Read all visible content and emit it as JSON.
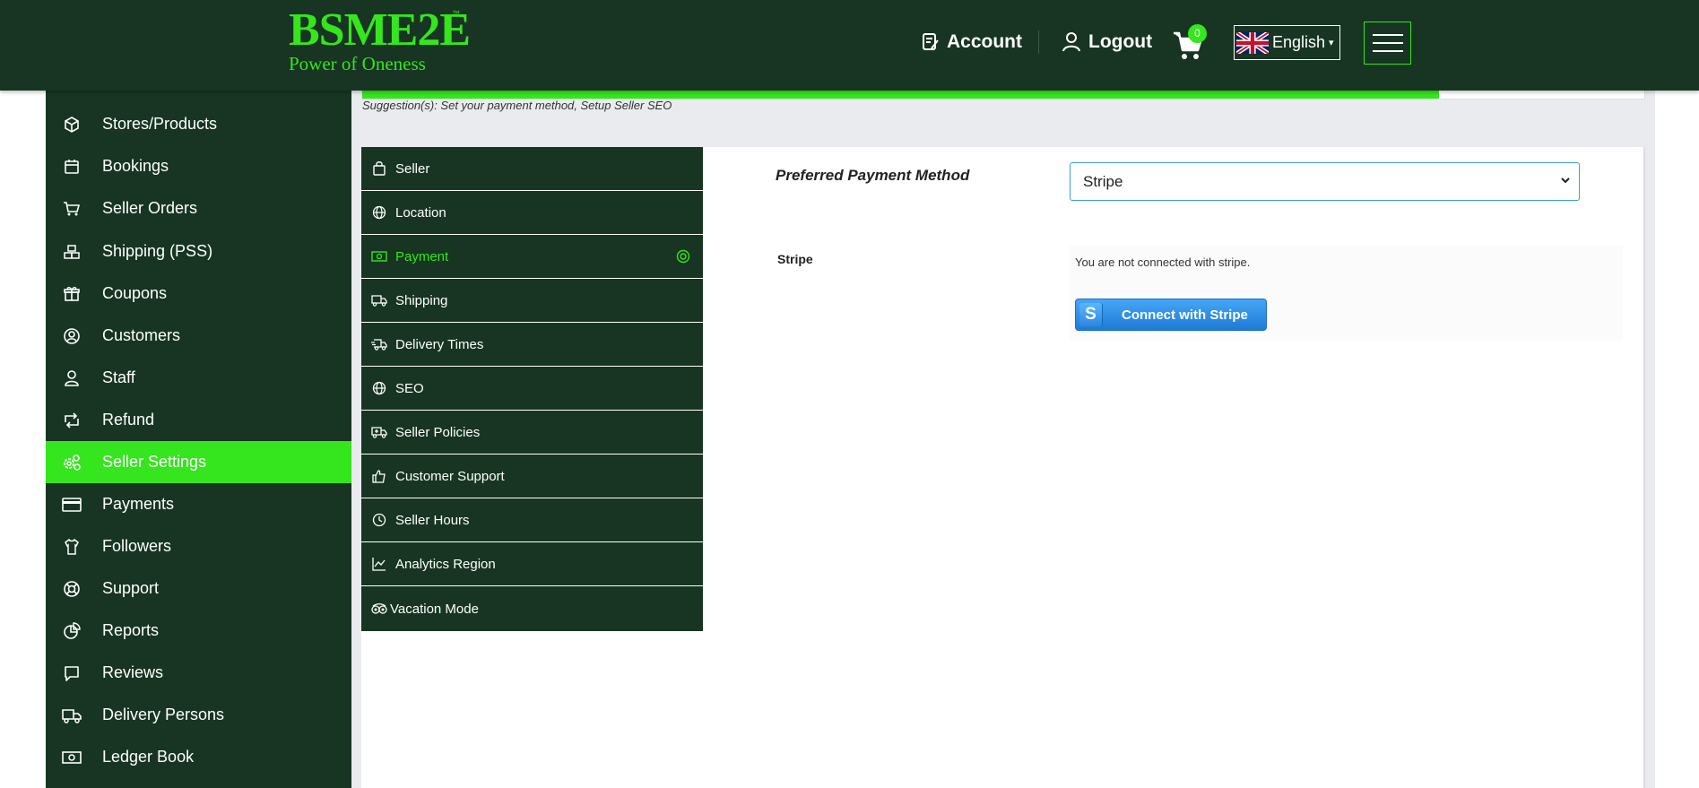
{
  "header": {
    "logo_main": "BSME2E",
    "logo_tm": "™",
    "logo_sub": "Power of Oneness",
    "account_label": "Account",
    "logout_label": "Logout",
    "cart_count": "0",
    "language": "English",
    "language_caret": "▾"
  },
  "sidebar": {
    "items": [
      {
        "label": "Stores/Products",
        "icon": "box-icon"
      },
      {
        "label": "Bookings",
        "icon": "calendar-icon"
      },
      {
        "label": "Seller Orders",
        "icon": "cart-icon"
      },
      {
        "label": "Shipping (PSS)",
        "icon": "boxes-icon"
      },
      {
        "label": "Coupons",
        "icon": "gift-icon"
      },
      {
        "label": "Customers",
        "icon": "user-circle-icon"
      },
      {
        "label": "Staff",
        "icon": "user-icon"
      },
      {
        "label": "Refund",
        "icon": "retweet-icon"
      },
      {
        "label": "Seller Settings",
        "icon": "cogs-icon"
      },
      {
        "label": "Payments",
        "icon": "credit-card-icon"
      },
      {
        "label": "Followers",
        "icon": "shirt-icon"
      },
      {
        "label": "Support",
        "icon": "life-ring-icon"
      },
      {
        "label": "Reports",
        "icon": "pie-chart-icon"
      },
      {
        "label": "Reviews",
        "icon": "comment-icon"
      },
      {
        "label": "Delivery Persons",
        "icon": "truck-icon"
      },
      {
        "label": "Ledger Book",
        "icon": "money-icon"
      }
    ],
    "active_index": 8
  },
  "progress": {
    "fraction": 0.84,
    "suggestion": "Suggestion(s): Set your payment method, Setup Seller SEO"
  },
  "settings_menu": {
    "items": [
      {
        "label": "Seller",
        "icon": "shopping-bag-icon"
      },
      {
        "label": "Location",
        "icon": "globe-icon"
      },
      {
        "label": "Payment",
        "icon": "money-bill-icon"
      },
      {
        "label": "Shipping",
        "icon": "truck-icon"
      },
      {
        "label": "Delivery Times",
        "icon": "shipping-fast-icon"
      },
      {
        "label": "SEO",
        "icon": "globe-icon"
      },
      {
        "label": "Seller Policies",
        "icon": "truck-medical-icon"
      },
      {
        "label": "Customer Support",
        "icon": "thumbs-up-icon"
      },
      {
        "label": "Seller Hours",
        "icon": "clock-icon"
      },
      {
        "label": "Analytics Region",
        "icon": "line-chart-icon"
      },
      {
        "label": "Vacation Mode",
        "icon": "tripadvisor-icon"
      }
    ],
    "active_index": 2
  },
  "payment": {
    "preferred_label": "Preferred Payment Method",
    "preferred_value": "Stripe",
    "stripe_label": "Stripe",
    "stripe_status": "You are not connected with stripe.",
    "connect_button": "Connect with Stripe",
    "stripe_logo_letter": "S"
  },
  "colors": {
    "brand_dark": "#173522",
    "accent_green": "#35e51e",
    "stripe_blue": "#2d86e0"
  }
}
